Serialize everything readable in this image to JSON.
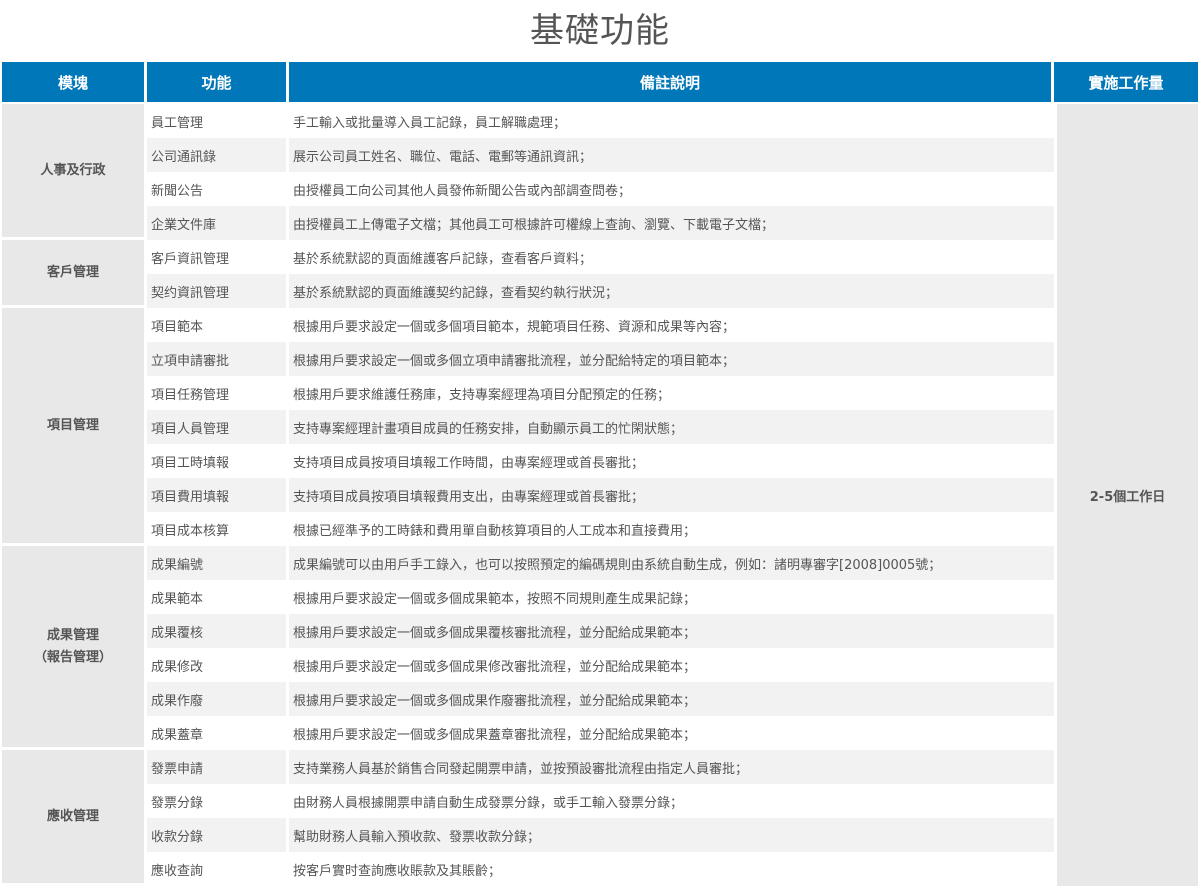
{
  "title": "基礎功能",
  "headers": {
    "module": "模塊",
    "function": "功能",
    "note": "備註說明",
    "effort": "實施工作量"
  },
  "effort_value": "2-5個工作日",
  "modules": [
    {
      "name": "人事及行政",
      "rows": [
        {
          "function": "員工管理",
          "note": "手工輸入或批量導入員工記錄，員工解職處理；"
        },
        {
          "function": "公司通訊錄",
          "note": "展示公司員工姓名、職位、電話、電郵等通訊資訊；"
        },
        {
          "function": "新聞公告",
          "note": "由授權員工向公司其他人員發佈新聞公告或內部調查問卷；"
        },
        {
          "function": "企業文件庫",
          "note": "由授權員工上傳電子文檔；其他員工可根據許可權線上查詢、瀏覽、下載電子文檔；"
        }
      ]
    },
    {
      "name": "客戶管理",
      "rows": [
        {
          "function": "客戶資訊管理",
          "note": "基於系統默認的頁面維護客戶記錄，查看客戶資料；"
        },
        {
          "function": "契约資訊管理",
          "note": "基於系統默認的頁面維護契约記錄，查看契约執行狀況；"
        }
      ]
    },
    {
      "name": "項目管理",
      "rows": [
        {
          "function": "項目範本",
          "note": "根據用戶要求設定一個或多個項目範本，規範項目任務、資源和成果等內容；"
        },
        {
          "function": "立項申請審批",
          "note": "根據用戶要求設定一個或多個立項申請審批流程，並分配給特定的項目範本；"
        },
        {
          "function": "項目任務管理",
          "note": "根據用戶要求維護任務庫，支持專案經理為項目分配預定的任務；"
        },
        {
          "function": "項目人員管理",
          "note": "支持專案經理計畫項目成員的任務安排，自動顯示員工的忙閑狀態；"
        },
        {
          "function": "項目工時填報",
          "note": "支持項目成員按項目填報工作時間，由專案經理或首長審批；"
        },
        {
          "function": "項目費用填報",
          "note": "支持項目成員按項目填報費用支出，由專案經理或首長審批；"
        },
        {
          "function": "項目成本核算",
          "note": "根據已經準予的工時錶和費用單自動核算項目的人工成本和直接費用；"
        }
      ]
    },
    {
      "name_line1": "成果管理",
      "name_line2": "（報告管理）",
      "rows": [
        {
          "function": "成果編號",
          "note": "成果編號可以由用戶手工錄入，也可以按照預定的編碼規則由系統自動生成，例如：諸明專審字[2008]0005號；"
        },
        {
          "function": "成果範本",
          "note": "根據用戶要求設定一個或多個成果範本，按照不同規則產生成果記錄；"
        },
        {
          "function": "成果覆核",
          "note": "根據用戶要求設定一個或多個成果覆核審批流程，並分配給成果範本；"
        },
        {
          "function": "成果修改",
          "note": "根據用戶要求設定一個或多個成果修改審批流程，並分配給成果範本；"
        },
        {
          "function": "成果作廢",
          "note": "根據用戶要求設定一個或多個成果作廢審批流程，並分配給成果範本；"
        },
        {
          "function": "成果蓋章",
          "note": "根據用戶要求設定一個或多個成果蓋章審批流程，並分配給成果範本；"
        }
      ]
    },
    {
      "name": "應收管理",
      "rows": [
        {
          "function": "發票申請",
          "note": "支持業務人員基於銷售合同發起開票申請，並按預設審批流程由指定人員審批；"
        },
        {
          "function": "發票分錄",
          "note": "由財務人員根據開票申請自動生成發票分錄，或手工輸入發票分錄；"
        },
        {
          "function": "收款分錄",
          "note": "幫助財務人員輸入預收款、發票收款分錄；"
        },
        {
          "function": "應收查詢",
          "note": "按客戶實时查詢應收賬款及其賬齡；"
        }
      ]
    }
  ]
}
